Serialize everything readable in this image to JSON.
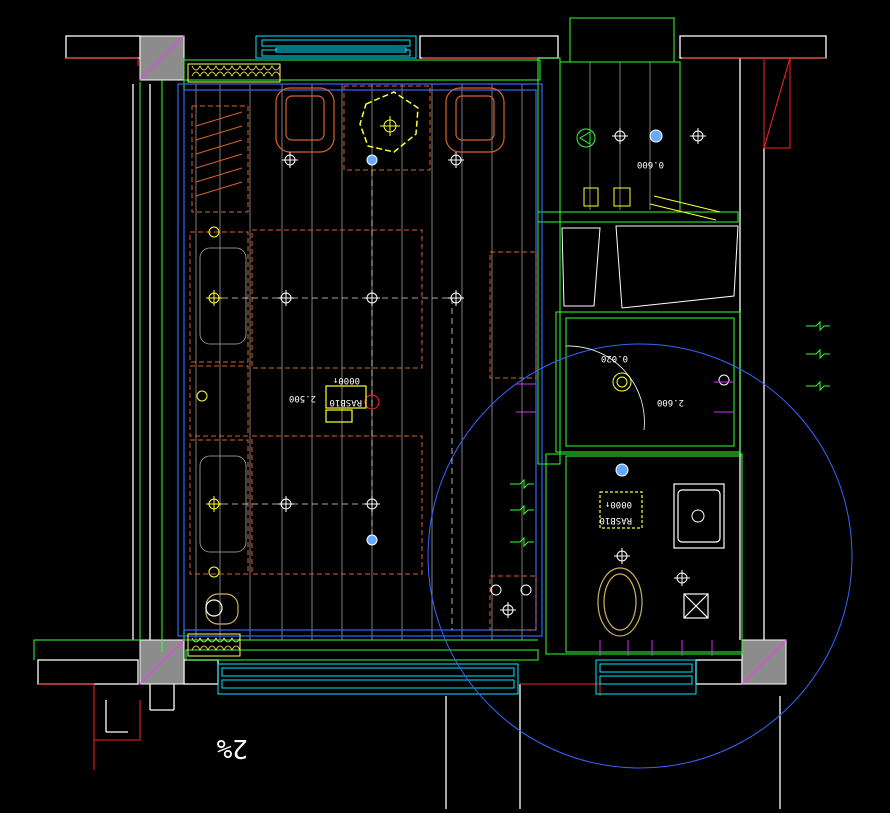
{
  "drawing": {
    "background": "#000000",
    "slope_label": "2%",
    "fixture_labels": [
      {
        "id": "label-lamp-1",
        "text": "0000↑"
      },
      {
        "id": "label-lamp-2",
        "text": "RASB10"
      },
      {
        "id": "label-fixture-3",
        "text": "2.500"
      },
      {
        "id": "label-fixture-4",
        "text": "0.020"
      },
      {
        "id": "label-fixture-5",
        "text": "2.600"
      },
      {
        "id": "label-fixture-6",
        "text": "0.600"
      },
      {
        "id": "label-fixture-7",
        "text": "0000↑"
      },
      {
        "id": "label-fixture-8",
        "text": "RASB10"
      }
    ],
    "colors": {
      "wall": "#ffffff",
      "cyan": "#00e5ff",
      "green": "#33ff33",
      "yellow": "#ffff33",
      "orange": "#d9602a",
      "blue": "#3366ff",
      "red": "#ff2222",
      "magenta": "#cc33ff",
      "grey": "#9a9a9a"
    }
  }
}
